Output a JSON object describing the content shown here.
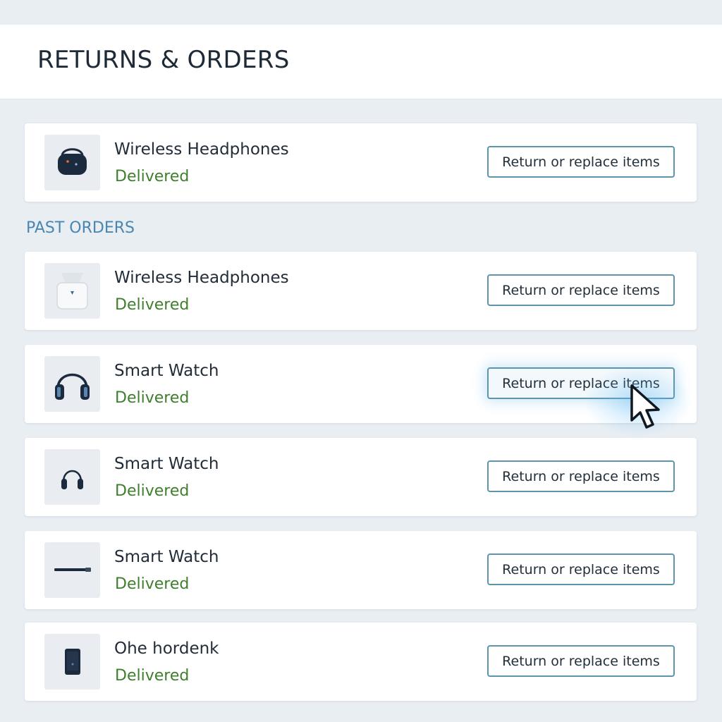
{
  "header": {
    "title": "RETURNS & ORDERS"
  },
  "current_order": {
    "name": "Wireless Headphones",
    "status": "Delivered",
    "action_label": "Return or replace items",
    "icon": "headphone-case-icon"
  },
  "past_orders": {
    "label": "PAST ORDERS",
    "items": [
      {
        "name": "Wireless Headphones",
        "status": "Delivered",
        "action_label": "Return or replace items",
        "icon": "earbuds-case-icon"
      },
      {
        "name": "Smart Watch",
        "status": "Delivered",
        "action_label": "Return or replace items",
        "icon": "headphones-icon"
      },
      {
        "name": "Smart Watch",
        "status": "Delivered",
        "action_label": "Return or replace items",
        "icon": "headphones-icon"
      },
      {
        "name": "Smart Watch",
        "status": "Delivered",
        "action_label": "Return or replace items",
        "icon": "cable-icon"
      },
      {
        "name": "Ohe hordenk",
        "status": "Delivered",
        "action_label": "Return or replace items",
        "icon": "phone-icon"
      }
    ]
  },
  "colors": {
    "background": "#e9eef3",
    "status_green": "#3e7f2c",
    "section_label_blue": "#4a86b0",
    "button_border": "#5b95ae"
  }
}
